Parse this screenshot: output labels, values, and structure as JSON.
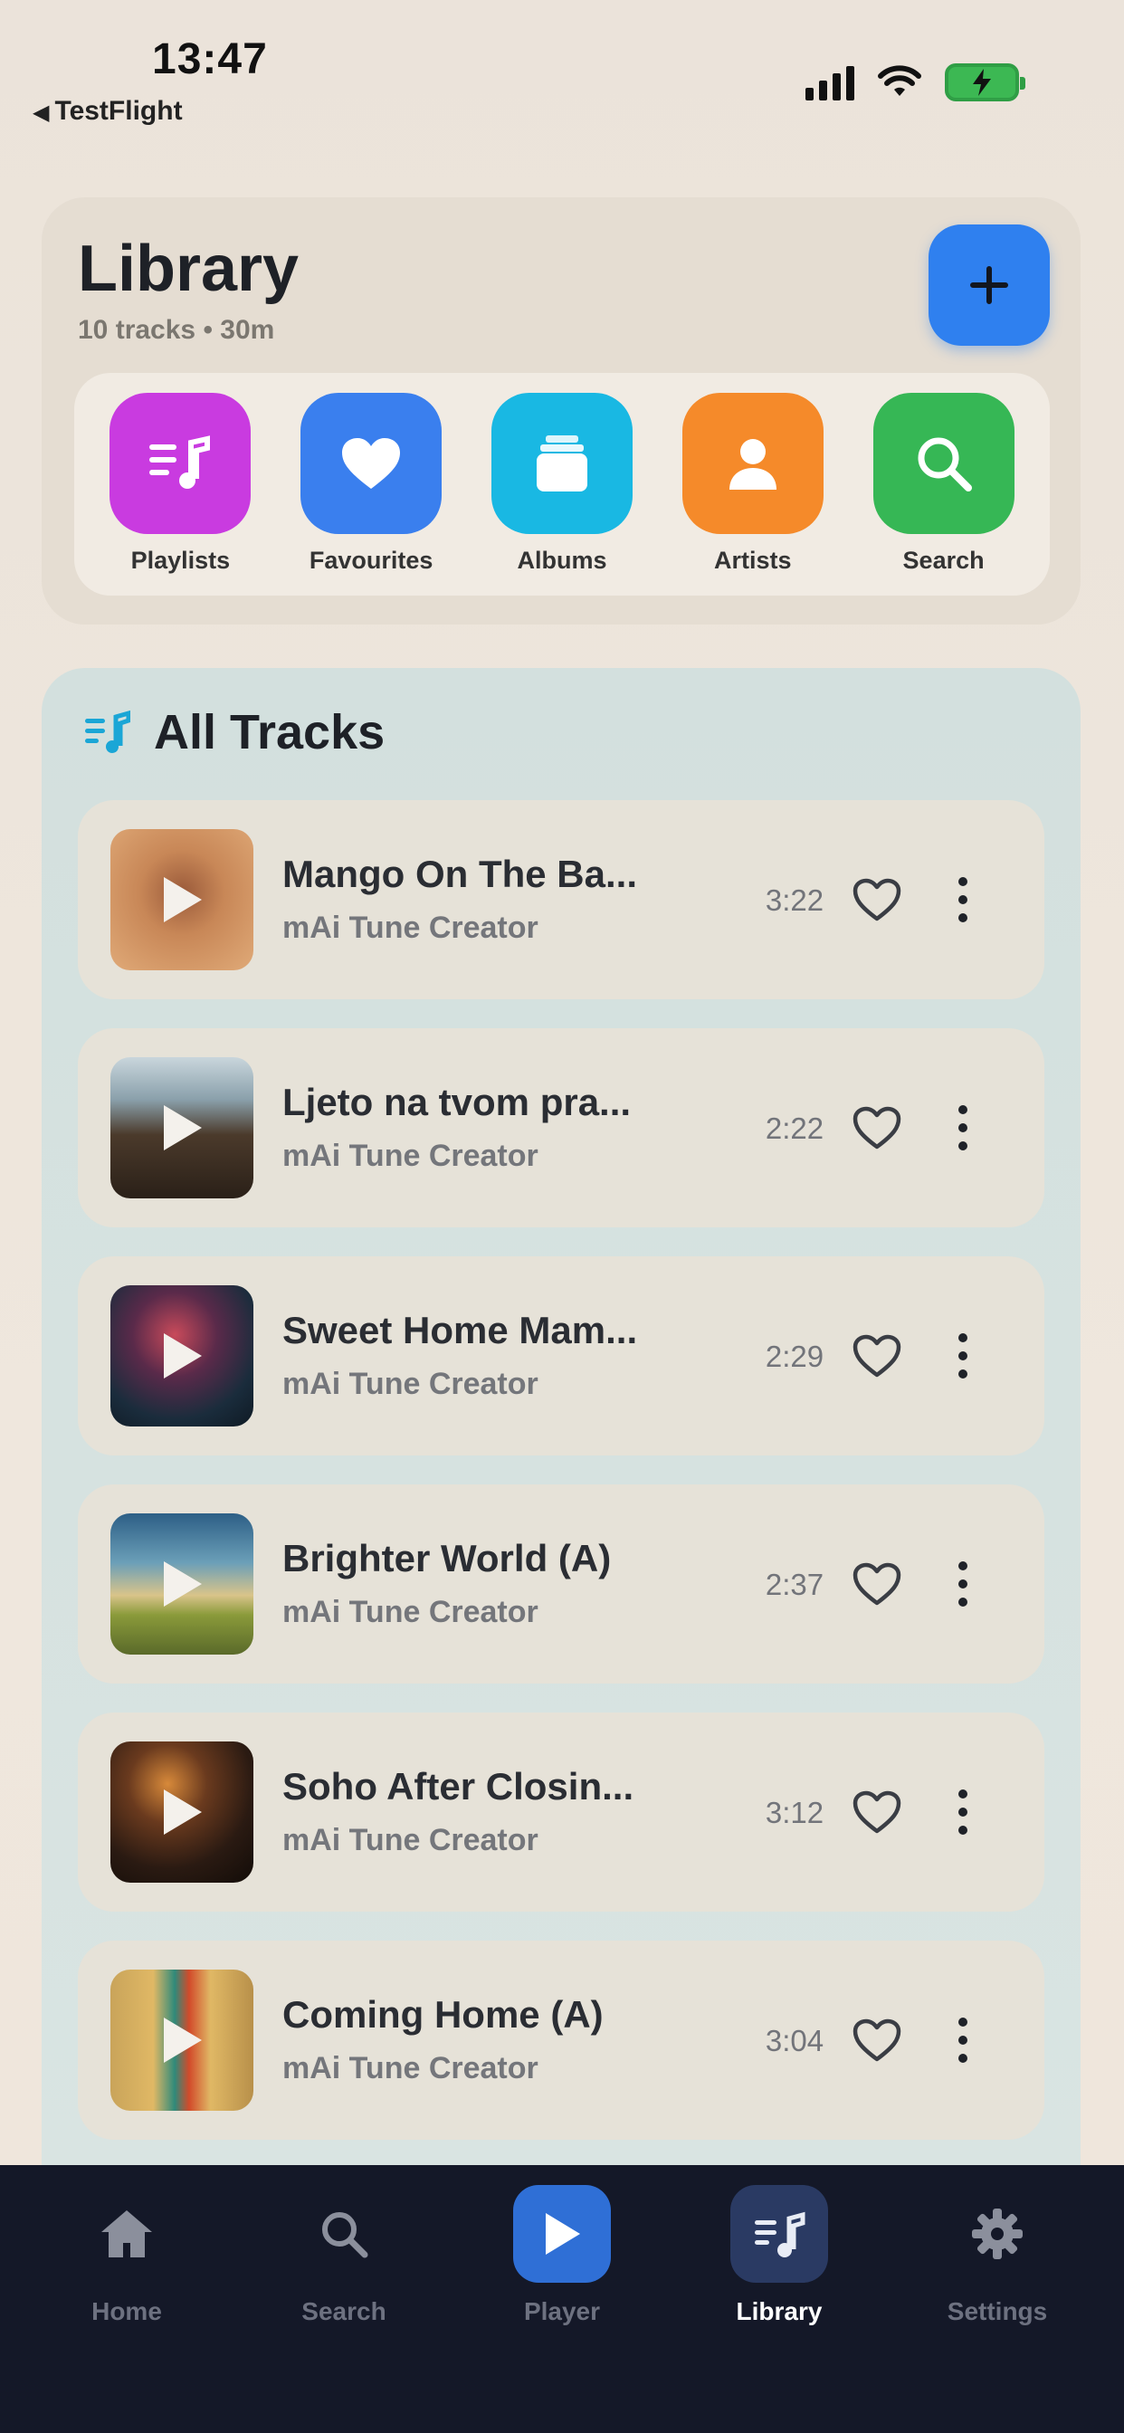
{
  "status_bar": {
    "time": "13:47",
    "back_label": "TestFlight",
    "back_icon": "back-triangle-icon",
    "battery_color": "#3cb853"
  },
  "library": {
    "title": "Library",
    "subtitle": "10 tracks • 30m",
    "add_icon": "plus-icon",
    "accent": "#2f80ef",
    "quick_actions": [
      {
        "label": "Playlists",
        "icon": "playlist-icon",
        "color": "#c93be0"
      },
      {
        "label": "Favourites",
        "icon": "heart-icon",
        "color": "#3a7fee"
      },
      {
        "label": "Albums",
        "icon": "album-icon",
        "color": "#19b8e3"
      },
      {
        "label": "Artists",
        "icon": "person-icon",
        "color": "#f58a2a"
      },
      {
        "label": "Search",
        "icon": "search-icon",
        "color": "#36b755"
      }
    ]
  },
  "tracks_section": {
    "title": "All Tracks",
    "icon": "music-list-icon",
    "tracks": [
      {
        "title": "Mango On The Ba...",
        "artist": "mAi Tune Creator",
        "duration": "3:22"
      },
      {
        "title": "Ljeto na tvom pra...",
        "artist": "mAi Tune Creator",
        "duration": "2:22"
      },
      {
        "title": "Sweet Home Mam...",
        "artist": "mAi Tune Creator",
        "duration": "2:29"
      },
      {
        "title": "Brighter World (A)",
        "artist": "mAi Tune Creator",
        "duration": "2:37"
      },
      {
        "title": "Soho After Closin...",
        "artist": "mAi Tune Creator",
        "duration": "3:12"
      },
      {
        "title": "Coming Home (A)",
        "artist": "mAi Tune Creator",
        "duration": "3:04"
      }
    ]
  },
  "tab_bar": {
    "tabs": [
      {
        "label": "Home",
        "icon": "home-icon"
      },
      {
        "label": "Search",
        "icon": "search-icon"
      },
      {
        "label": "Player",
        "icon": "play-icon"
      },
      {
        "label": "Library",
        "icon": "music-list-icon",
        "active": true
      },
      {
        "label": "Settings",
        "icon": "gear-icon"
      }
    ]
  }
}
